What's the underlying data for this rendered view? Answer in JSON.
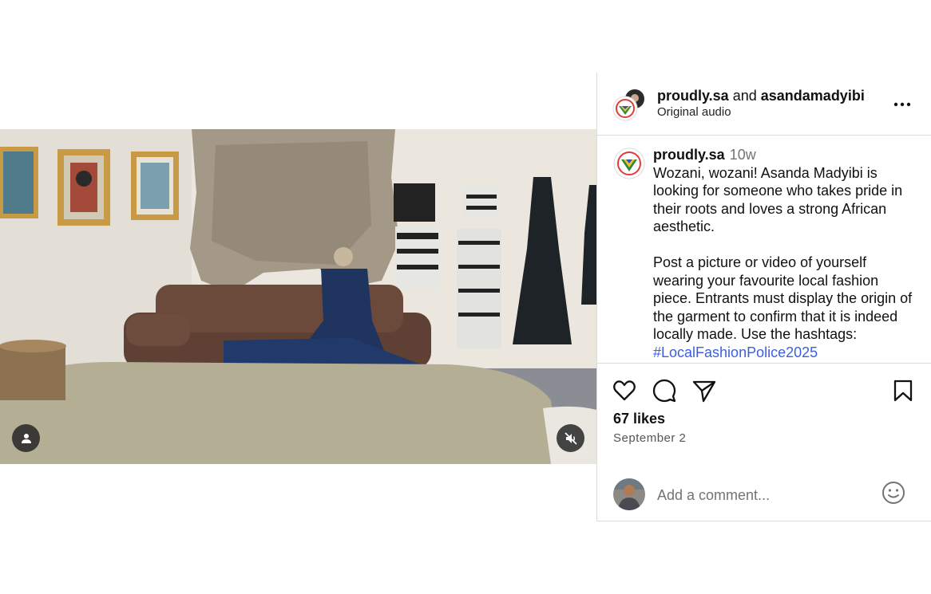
{
  "post": {
    "header": {
      "user1": "proudly.sa",
      "joiner": "and",
      "user2": "asandamadyibi",
      "audio": "Original audio",
      "more_icon": "more-horizontal-icon"
    },
    "caption": {
      "username": "proudly.sa",
      "time": "10w",
      "body": "Wozani, wozani! Asanda Madyibi is looking for someone who takes pride in their roots and loves a strong African aesthetic.\n\nPost a picture or video of yourself wearing your favourite local fashion piece. Entrants must display the origin of the garment to confirm that it is indeed locally made. Use the hashtags:",
      "hashtag": "#LocalFashionPolice2025"
    },
    "actions": {
      "like_icon": "heart-icon",
      "comment_icon": "comment-icon",
      "share_icon": "send-icon",
      "save_icon": "bookmark-icon"
    },
    "likes": "67 likes",
    "date": "September 2",
    "comment": {
      "placeholder": "Add a comment...",
      "emoji_icon": "smiley-icon"
    },
    "video": {
      "user_tag_icon": "person-icon",
      "mute_icon": "muted-speaker-icon"
    }
  },
  "colors": {
    "hashtag": "#3b5fe0",
    "border": "#dbdbdb",
    "muted_text": "#737373"
  }
}
